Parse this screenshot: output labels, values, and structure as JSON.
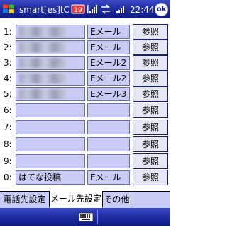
{
  "titlebar": {
    "title": "smart[es]tC",
    "time": "22:44",
    "ok_label": "ok"
  },
  "rows": [
    {
      "num": "1:",
      "name": "",
      "blurred": true,
      "kind": "Eメール",
      "ref": "参照"
    },
    {
      "num": "2:",
      "name": "",
      "blurred": true,
      "kind": "Eメール",
      "ref": "参照"
    },
    {
      "num": "3:",
      "name": "",
      "blurred": true,
      "kind": "Eメール2",
      "ref": "参照"
    },
    {
      "num": "4:",
      "name": "",
      "blurred": true,
      "kind": "Eメール2",
      "ref": "参照"
    },
    {
      "num": "5:",
      "name": "",
      "blurred": true,
      "kind": "Eメール3",
      "ref": "参照"
    },
    {
      "num": "6:",
      "name": "",
      "blurred": false,
      "kind": "",
      "ref": "参照"
    },
    {
      "num": "7:",
      "name": "",
      "blurred": false,
      "kind": "",
      "ref": "参照"
    },
    {
      "num": "8:",
      "name": "",
      "blurred": false,
      "kind": "",
      "ref": "参照"
    },
    {
      "num": "9:",
      "name": "",
      "blurred": false,
      "kind": "",
      "ref": "参照"
    },
    {
      "num": "0:",
      "name": "はてな投稿",
      "blurred": false,
      "kind": "Eメール",
      "ref": "参照"
    }
  ],
  "tabs": [
    {
      "label": "電話先設定",
      "selected": false
    },
    {
      "label": "メール先設定",
      "selected": true
    },
    {
      "label": "その他",
      "selected": false
    }
  ],
  "colors": {
    "bar": "#1c2a9e",
    "field": "#c8ccf4",
    "button": "#e4e6f4"
  },
  "icons": [
    "windows-start-icon",
    "mail-notification-icon",
    "signal-icon",
    "sync-icon",
    "volume-icon",
    "keyboard-icon"
  ]
}
